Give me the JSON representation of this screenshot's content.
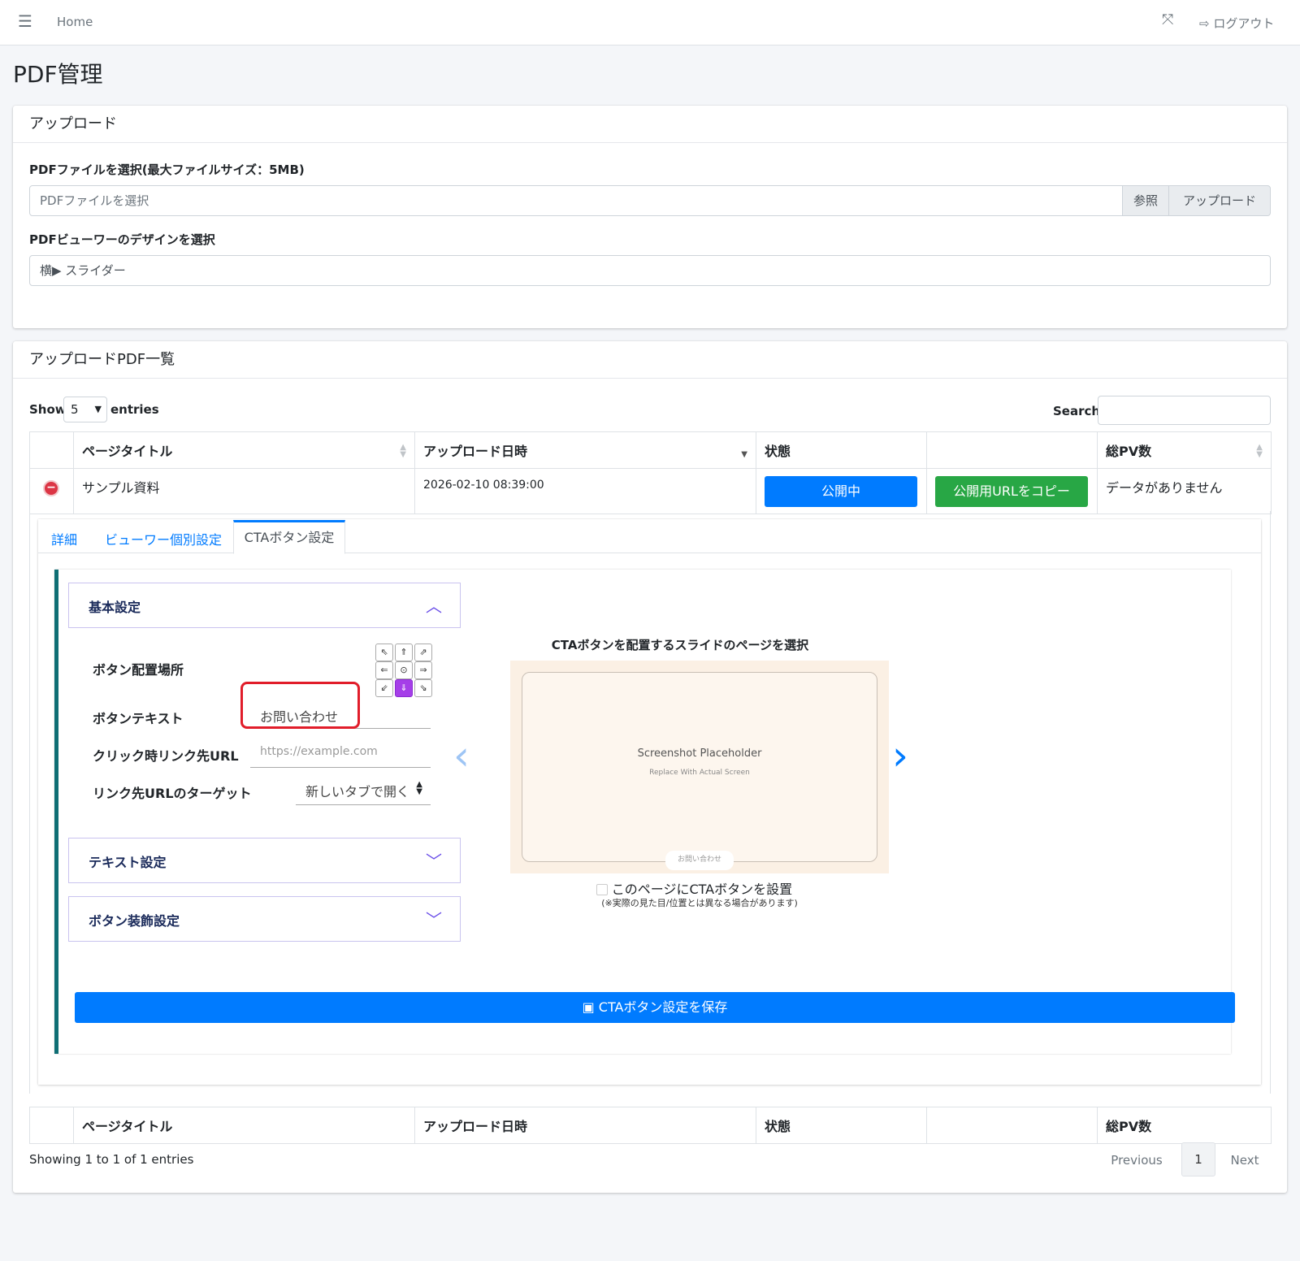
{
  "nav": {
    "menu_icon": "hamburger-icon",
    "home": "Home",
    "expand_icon": "expand-icon",
    "logout": "ログアウト"
  },
  "page": {
    "title": "PDF管理"
  },
  "upload": {
    "header": "アップロード",
    "file_label": "PDFファイルを選択(最大ファイルサイズ：5MB)",
    "file_placeholder": "PDFファイルを選択",
    "browse": "参照",
    "upload_button": "アップロード",
    "design_label": "PDFビューワーのデザインを選択",
    "design_value": "横▶ スライダー"
  },
  "list": {
    "header": "アップロードPDF一覧",
    "show": "Show",
    "entries_value": "5",
    "entries": "entries",
    "search_label": "Search:",
    "columns": [
      "ページタイトル",
      "アップロード日時",
      "状態",
      "",
      "総PV数"
    ],
    "row": {
      "title": "サンプル資料",
      "date": "2026-02-10 08:39:00",
      "status_button": "公開中",
      "copy_button": "公開用URLをコピー",
      "pv": "データがありません"
    },
    "footer_columns": [
      "ページタイトル",
      "アップロード日時",
      "状態",
      "",
      "総PV数"
    ],
    "info": "Showing 1 to 1 of 1 entries",
    "pagination": {
      "previous": "Previous",
      "current": "1",
      "next": "Next"
    }
  },
  "tabs": [
    "詳細",
    "ビューワー個別設定",
    "CTAボタン設定"
  ],
  "cta": {
    "basic_title": "基本設定",
    "position_label": "ボタン配置場所",
    "text_label": "ボタンテキスト",
    "text_value": "お問い合わせ",
    "url_label": "クリック時リンク先URL",
    "url_placeholder": "https://example.com",
    "target_label": "リンク先URLのターゲット",
    "target_value": "新しいタブで開く",
    "text_settings": "テキスト設定",
    "decoration_settings": "ボタン装飾設定",
    "preview_title": "CTAボタンを配置するスライドのページを選択",
    "placeholder_main": "Screenshot Placeholder",
    "placeholder_sub": "Replace With Actual Screen",
    "preview_button": "お問い合わせ",
    "checkbox_label": "このページにCTAボタンを設置",
    "note": "(※実際の見た目/位置とは異なる場合があります)",
    "save_button": "CTAボタン設定を保存",
    "grid": [
      "⇖",
      "⇑",
      "⇗",
      "⇐",
      "⊙",
      "⇒",
      "⇙",
      "⇓",
      "⇘"
    ],
    "selected_position": "⇓"
  },
  "colors": {
    "primary": "#007bff",
    "success": "#28a745",
    "accent": "#a53ee8",
    "highlight": "#e11d2a"
  }
}
